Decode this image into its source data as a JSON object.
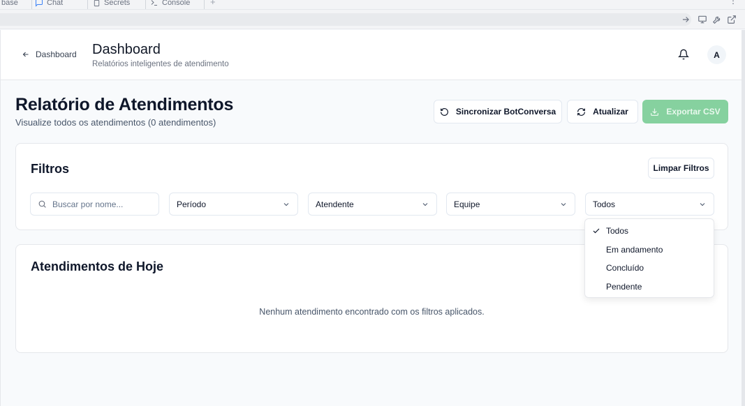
{
  "browser": {
    "tabs": [
      {
        "label": "base",
        "icon": "doc-icon"
      },
      {
        "label": "Chat",
        "icon": "chat-icon"
      },
      {
        "label": "Secrets",
        "icon": "lock-icon"
      },
      {
        "label": "Console",
        "icon": "terminal-icon"
      }
    ]
  },
  "header": {
    "back_label": "Dashboard",
    "title": "Dashboard",
    "subtitle": "Relatórios inteligentes de atendimento",
    "avatar_initial": "A"
  },
  "page": {
    "title": "Relatório de Atendimentos",
    "subtitle": "Visualize todos os atendimentos (0 atendimentos)"
  },
  "actions": {
    "sync_label": "Sincronizar BotConversa",
    "refresh_label": "Atualizar",
    "export_label": "Exportar CSV"
  },
  "filters": {
    "title": "Filtros",
    "clear_label": "Limpar Filtros",
    "search_placeholder": "Buscar por nome...",
    "period": "Período",
    "attendant": "Atendente",
    "team": "Equipe",
    "status": "Todos",
    "status_options": [
      "Todos",
      "Em andamento",
      "Concluído",
      "Pendente"
    ],
    "status_selected": "Todos"
  },
  "today": {
    "title": "Atendimentos de Hoje",
    "empty_message": "Nenhum atendimento encontrado com os filtros aplicados."
  },
  "colors": {
    "accent_export": "#86d19f",
    "border": "#e5e7eb",
    "text": "#0f172a"
  }
}
